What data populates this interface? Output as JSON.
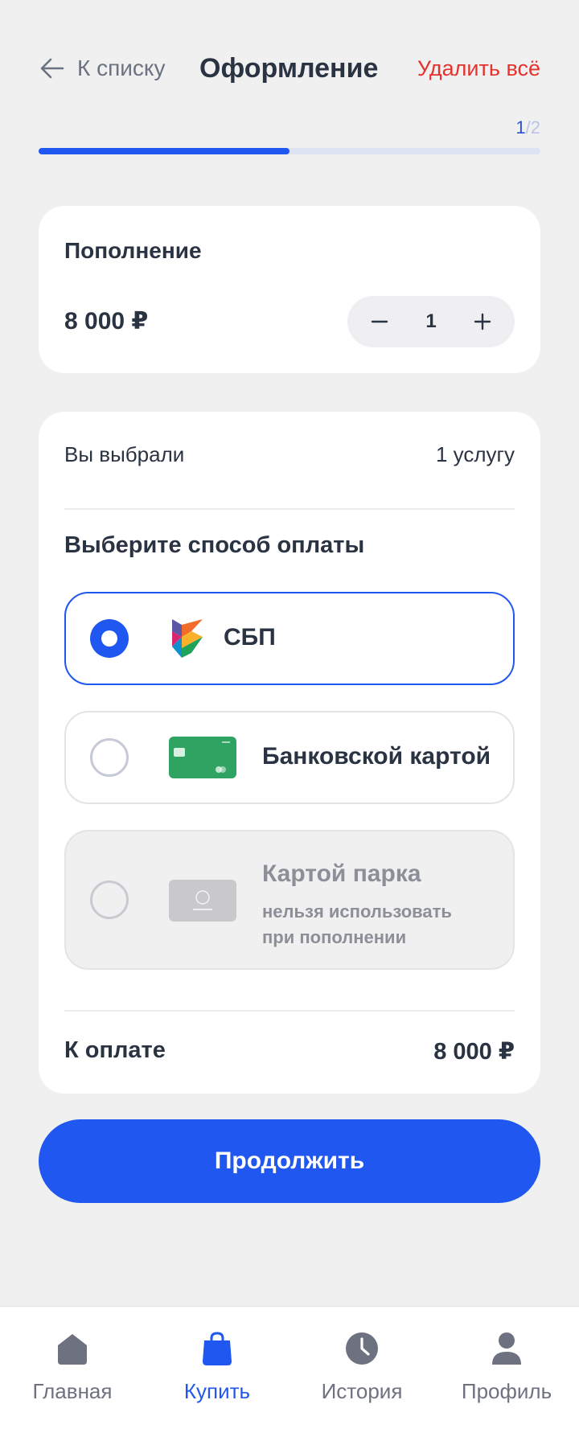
{
  "header": {
    "back_label": "К списку",
    "title": "Оформление",
    "delete_label": "Удалить всё"
  },
  "progress": {
    "current_step": "1",
    "separator": "/",
    "total_steps": "2",
    "fraction": 0.5
  },
  "item": {
    "title": "Пополнение",
    "price": "8 000 ₽",
    "quantity": "1"
  },
  "summary": {
    "selected_label": "Вы выбрали",
    "selected_value": "1 услугу",
    "payment_title": "Выберите способ оплаты",
    "total_label": "К оплате",
    "total_value": "8 000 ₽"
  },
  "payment_methods": [
    {
      "label": "СБП",
      "selected": true,
      "enabled": true
    },
    {
      "label": "Банковской картой",
      "selected": false,
      "enabled": true
    },
    {
      "label": "Картой парка",
      "sublabel": "нельзя использовать при пополнении",
      "selected": false,
      "enabled": false
    }
  ],
  "cta": {
    "label": "Продолжить"
  },
  "tabbar": {
    "items": [
      {
        "label": "Главная",
        "icon": "home-icon",
        "active": false
      },
      {
        "label": "Купить",
        "icon": "shopping-bag-icon",
        "active": true
      },
      {
        "label": "История",
        "icon": "clock-icon",
        "active": false
      },
      {
        "label": "Профиль",
        "icon": "user-icon",
        "active": false
      }
    ]
  },
  "colors": {
    "accent": "#1f57f0",
    "danger": "#e5322d",
    "background": "#f0f0f1",
    "card_green": "#2fa462"
  }
}
